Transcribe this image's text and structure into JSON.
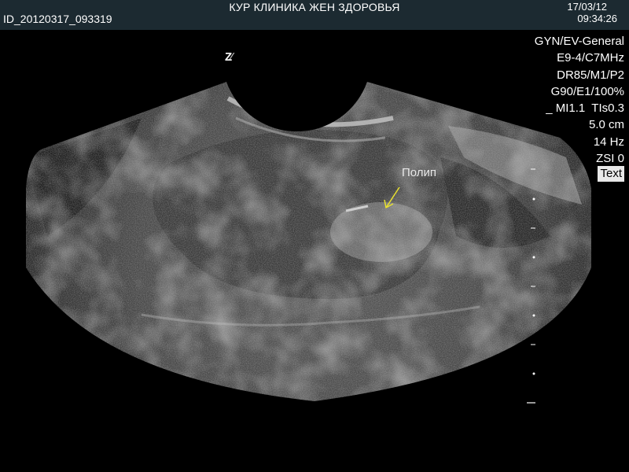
{
  "header": {
    "clinic_name": "КУР КЛИНИКА ЖЕН ЗДОРОВЬЯ",
    "patient_id": "ID_20120317_093319",
    "date": "17/03/12",
    "time": "09:34:26"
  },
  "parameters": [
    "GYN/EV-General",
    "E9-4/C7MHz",
    "DR85/M1/P2",
    "G90/E1/100%",
    "_ MI1.1  TIs0.3",
    "5.0 cm",
    "14 Hz",
    "ZSI 0"
  ],
  "text_button": "Text",
  "annotation": {
    "label": "Полип",
    "arrow_color": "#e8e030"
  },
  "orientation_marker": "Z",
  "depth_scale": {
    "major_tick_label": "_"
  },
  "colors": {
    "header_background": "#1c2a31",
    "text": "#ffffff",
    "text_button_background": "#e8e8e8"
  }
}
